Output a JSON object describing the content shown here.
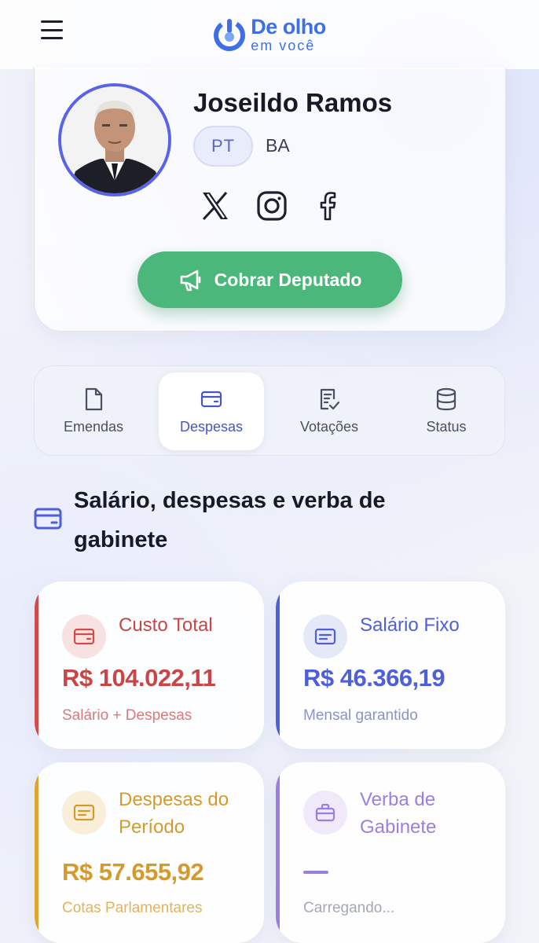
{
  "header": {
    "logo_title": "De olho",
    "logo_sub": "em você",
    "menu_icon": "hamburger-menu-icon"
  },
  "profile": {
    "name": "Joseildo Ramos",
    "party": "PT",
    "state": "BA",
    "social": [
      "x-icon",
      "instagram-icon",
      "facebook-icon"
    ],
    "cta_label": "Cobrar Deputado",
    "cta_icon": "megaphone-icon"
  },
  "tabs": [
    {
      "label": "Emendas",
      "icon": "document-icon"
    },
    {
      "label": "Despesas",
      "icon": "wallet-icon"
    },
    {
      "label": "Votações",
      "icon": "checklist-icon"
    },
    {
      "label": "Status",
      "icon": "database-icon"
    }
  ],
  "active_tab": "Despesas",
  "section": {
    "title": "Salário, despesas e verba de gabinete",
    "icon": "wallet-icon"
  },
  "cards": {
    "custo_total": {
      "label": "Custo Total",
      "value": "R$ 104.022,11",
      "desc": "Salário + Despesas",
      "color": "#d24a4a"
    },
    "salario_fixo": {
      "label": "Salário Fixo",
      "value": "R$ 46.366,19",
      "desc": "Mensal garantido",
      "color": "#4f5fd8"
    },
    "despesas_periodo": {
      "label": "Despesas do Período",
      "value": "R$ 57.655,92",
      "desc": "Cotas Parlamentares",
      "color": "#e0a32e"
    },
    "verba_gabinete": {
      "label": "Verba de Gabinete",
      "value": "—",
      "desc": "Carregando...",
      "color": "#9b7fe0"
    }
  }
}
